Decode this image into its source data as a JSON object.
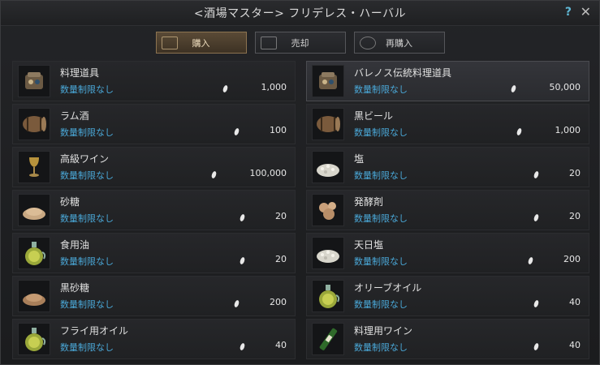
{
  "window": {
    "title": "<酒場マスター> フリデレス・ハーバル",
    "help": "?",
    "close": "✕"
  },
  "tabs": [
    {
      "label": "購入",
      "icon": "cart-icon",
      "active": true
    },
    {
      "label": "売却",
      "icon": "coins-icon",
      "active": false
    },
    {
      "label": "再購入",
      "icon": "repurchase-icon",
      "active": false
    }
  ],
  "items_left": [
    {
      "name": "料理道具",
      "limit": "数量制限なし",
      "price": "1,000",
      "icon": "cooking-utensil-icon"
    },
    {
      "name": "ラム酒",
      "limit": "数量制限なし",
      "price": "100",
      "icon": "barrel-icon"
    },
    {
      "name": "高級ワイン",
      "limit": "数量制限なし",
      "price": "100,000",
      "icon": "wine-glass-icon"
    },
    {
      "name": "砂糖",
      "limit": "数量制限なし",
      "price": "20",
      "icon": "sugar-pile-icon"
    },
    {
      "name": "食用油",
      "limit": "数量制限なし",
      "price": "20",
      "icon": "oil-jar-icon"
    },
    {
      "name": "黒砂糖",
      "limit": "数量制限なし",
      "price": "200",
      "icon": "brown-sugar-pile-icon"
    },
    {
      "name": "フライ用オイル",
      "limit": "数量制限なし",
      "price": "40",
      "icon": "oil-jar-icon"
    }
  ],
  "items_right": [
    {
      "name": "バレノス伝統料理道具",
      "limit": "数量制限なし",
      "price": "50,000",
      "icon": "cooking-utensil-icon"
    },
    {
      "name": "黒ビール",
      "limit": "数量制限なし",
      "price": "1,000",
      "icon": "barrel-icon"
    },
    {
      "name": "塩",
      "limit": "数量制限なし",
      "price": "20",
      "icon": "salt-pile-icon"
    },
    {
      "name": "発酵剤",
      "limit": "数量制限なし",
      "price": "20",
      "icon": "yeast-icon"
    },
    {
      "name": "天日塩",
      "limit": "数量制限なし",
      "price": "200",
      "icon": "salt-pile-icon"
    },
    {
      "name": "オリーブオイル",
      "limit": "数量制限なし",
      "price": "40",
      "icon": "oil-jar-icon"
    },
    {
      "name": "料理用ワイン",
      "limit": "数量制限なし",
      "price": "40",
      "icon": "wine-bottle-icon"
    }
  ],
  "colors": {
    "accent": "#4aa8d8",
    "tab_active": "#5a4a36",
    "highlight_help": "#5fb7d4"
  }
}
